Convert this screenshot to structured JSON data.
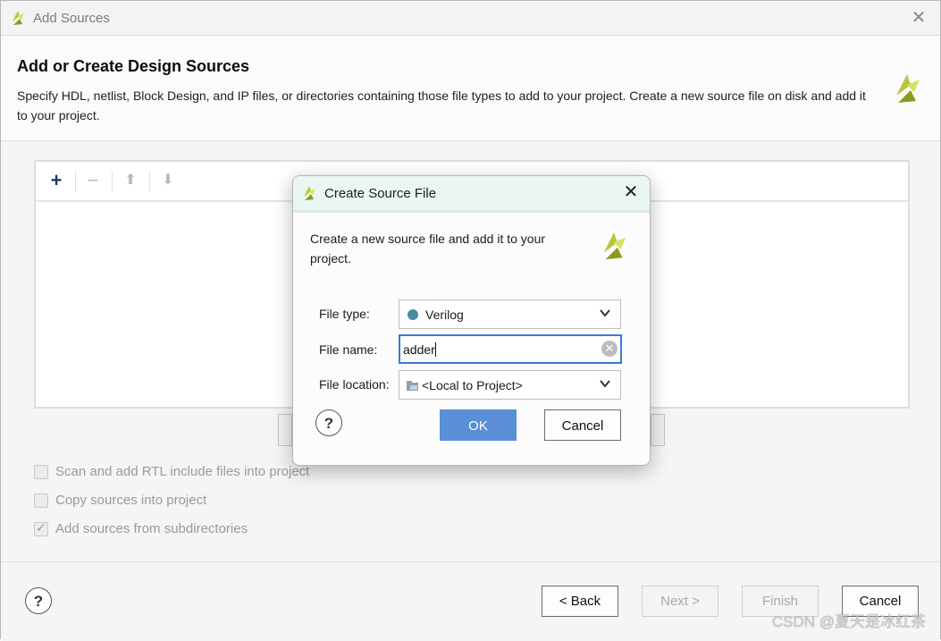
{
  "window": {
    "title": "Add Sources",
    "close_icon": "close-icon"
  },
  "header": {
    "title": "Add or Create Design Sources",
    "description": "Specify HDL, netlist, Block Design, and IP files, or directories containing those file types to add to your project. Create a new source file on disk and add it to your project."
  },
  "toolbar": {
    "add_glyph": "+",
    "remove_glyph": "−",
    "up_glyph": "⬆",
    "down_glyph": "⬇"
  },
  "options": [
    {
      "label": "Scan and add RTL include files into project",
      "checked": false
    },
    {
      "label": "Copy sources into project",
      "checked": false
    },
    {
      "label": "Add sources from subdirectories",
      "checked": true
    }
  ],
  "footer": {
    "help": "?",
    "back": "< Back",
    "next": "Next >",
    "finish": "Finish",
    "cancel": "Cancel"
  },
  "dialog": {
    "title": "Create Source File",
    "close": "✕",
    "intro": "Create a new source file and add it to your project.",
    "file_type_label": "File type:",
    "file_type_value": "Verilog",
    "file_name_label": "File name:",
    "file_name_value": "adder",
    "file_location_label": "File location:",
    "file_location_value": "<Local to Project>",
    "help": "?",
    "ok": "OK",
    "cancel": "Cancel"
  },
  "watermark": "CSDN @夏天是冰红茶",
  "colors": {
    "ok_button": "#5b8fd6",
    "dialog_titlebar": "#e9f6f4",
    "verilog_dot": "#4a8aa3",
    "input_focus": "#3b7bd4"
  }
}
